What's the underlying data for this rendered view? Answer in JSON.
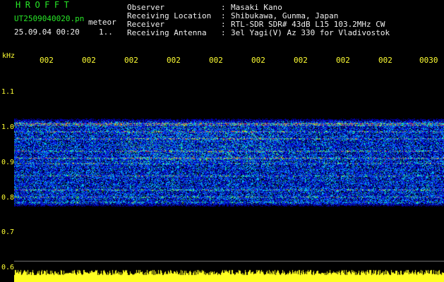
{
  "header": {
    "app_title": "HROFFT",
    "file_name": "UT2509040020.pn",
    "meteor_label": "meteor",
    "date_time": "25.09.04 00:20",
    "scale_num": "1.."
  },
  "info": [
    {
      "label": "Observer",
      "value": "Masaki Kano"
    },
    {
      "label": "Receiving Location",
      "value": "Shibukawa, Gunma, Japan"
    },
    {
      "label": "Receiver",
      "value": "RTL-SDR SDR# 43dB L15 103.2MHz CW"
    },
    {
      "label": "Receiving Antenna",
      "value": "3el Yagi(V) Az 330 for Vladivostok"
    }
  ],
  "info_separator": ":",
  "y_axis": {
    "unit": "kHz",
    "ticks": [
      "1.1",
      "1.0",
      "0.9",
      "0.8",
      "0.7",
      "0.6"
    ]
  },
  "x_axis": {
    "ticks": [
      "002",
      "002",
      "002",
      "002",
      "002",
      "002",
      "002",
      "002",
      "002",
      "0030"
    ]
  },
  "colors": {
    "title": "#27e627",
    "text": "#f0f0f0",
    "axis": "#ffff33",
    "background": "#000000"
  }
}
